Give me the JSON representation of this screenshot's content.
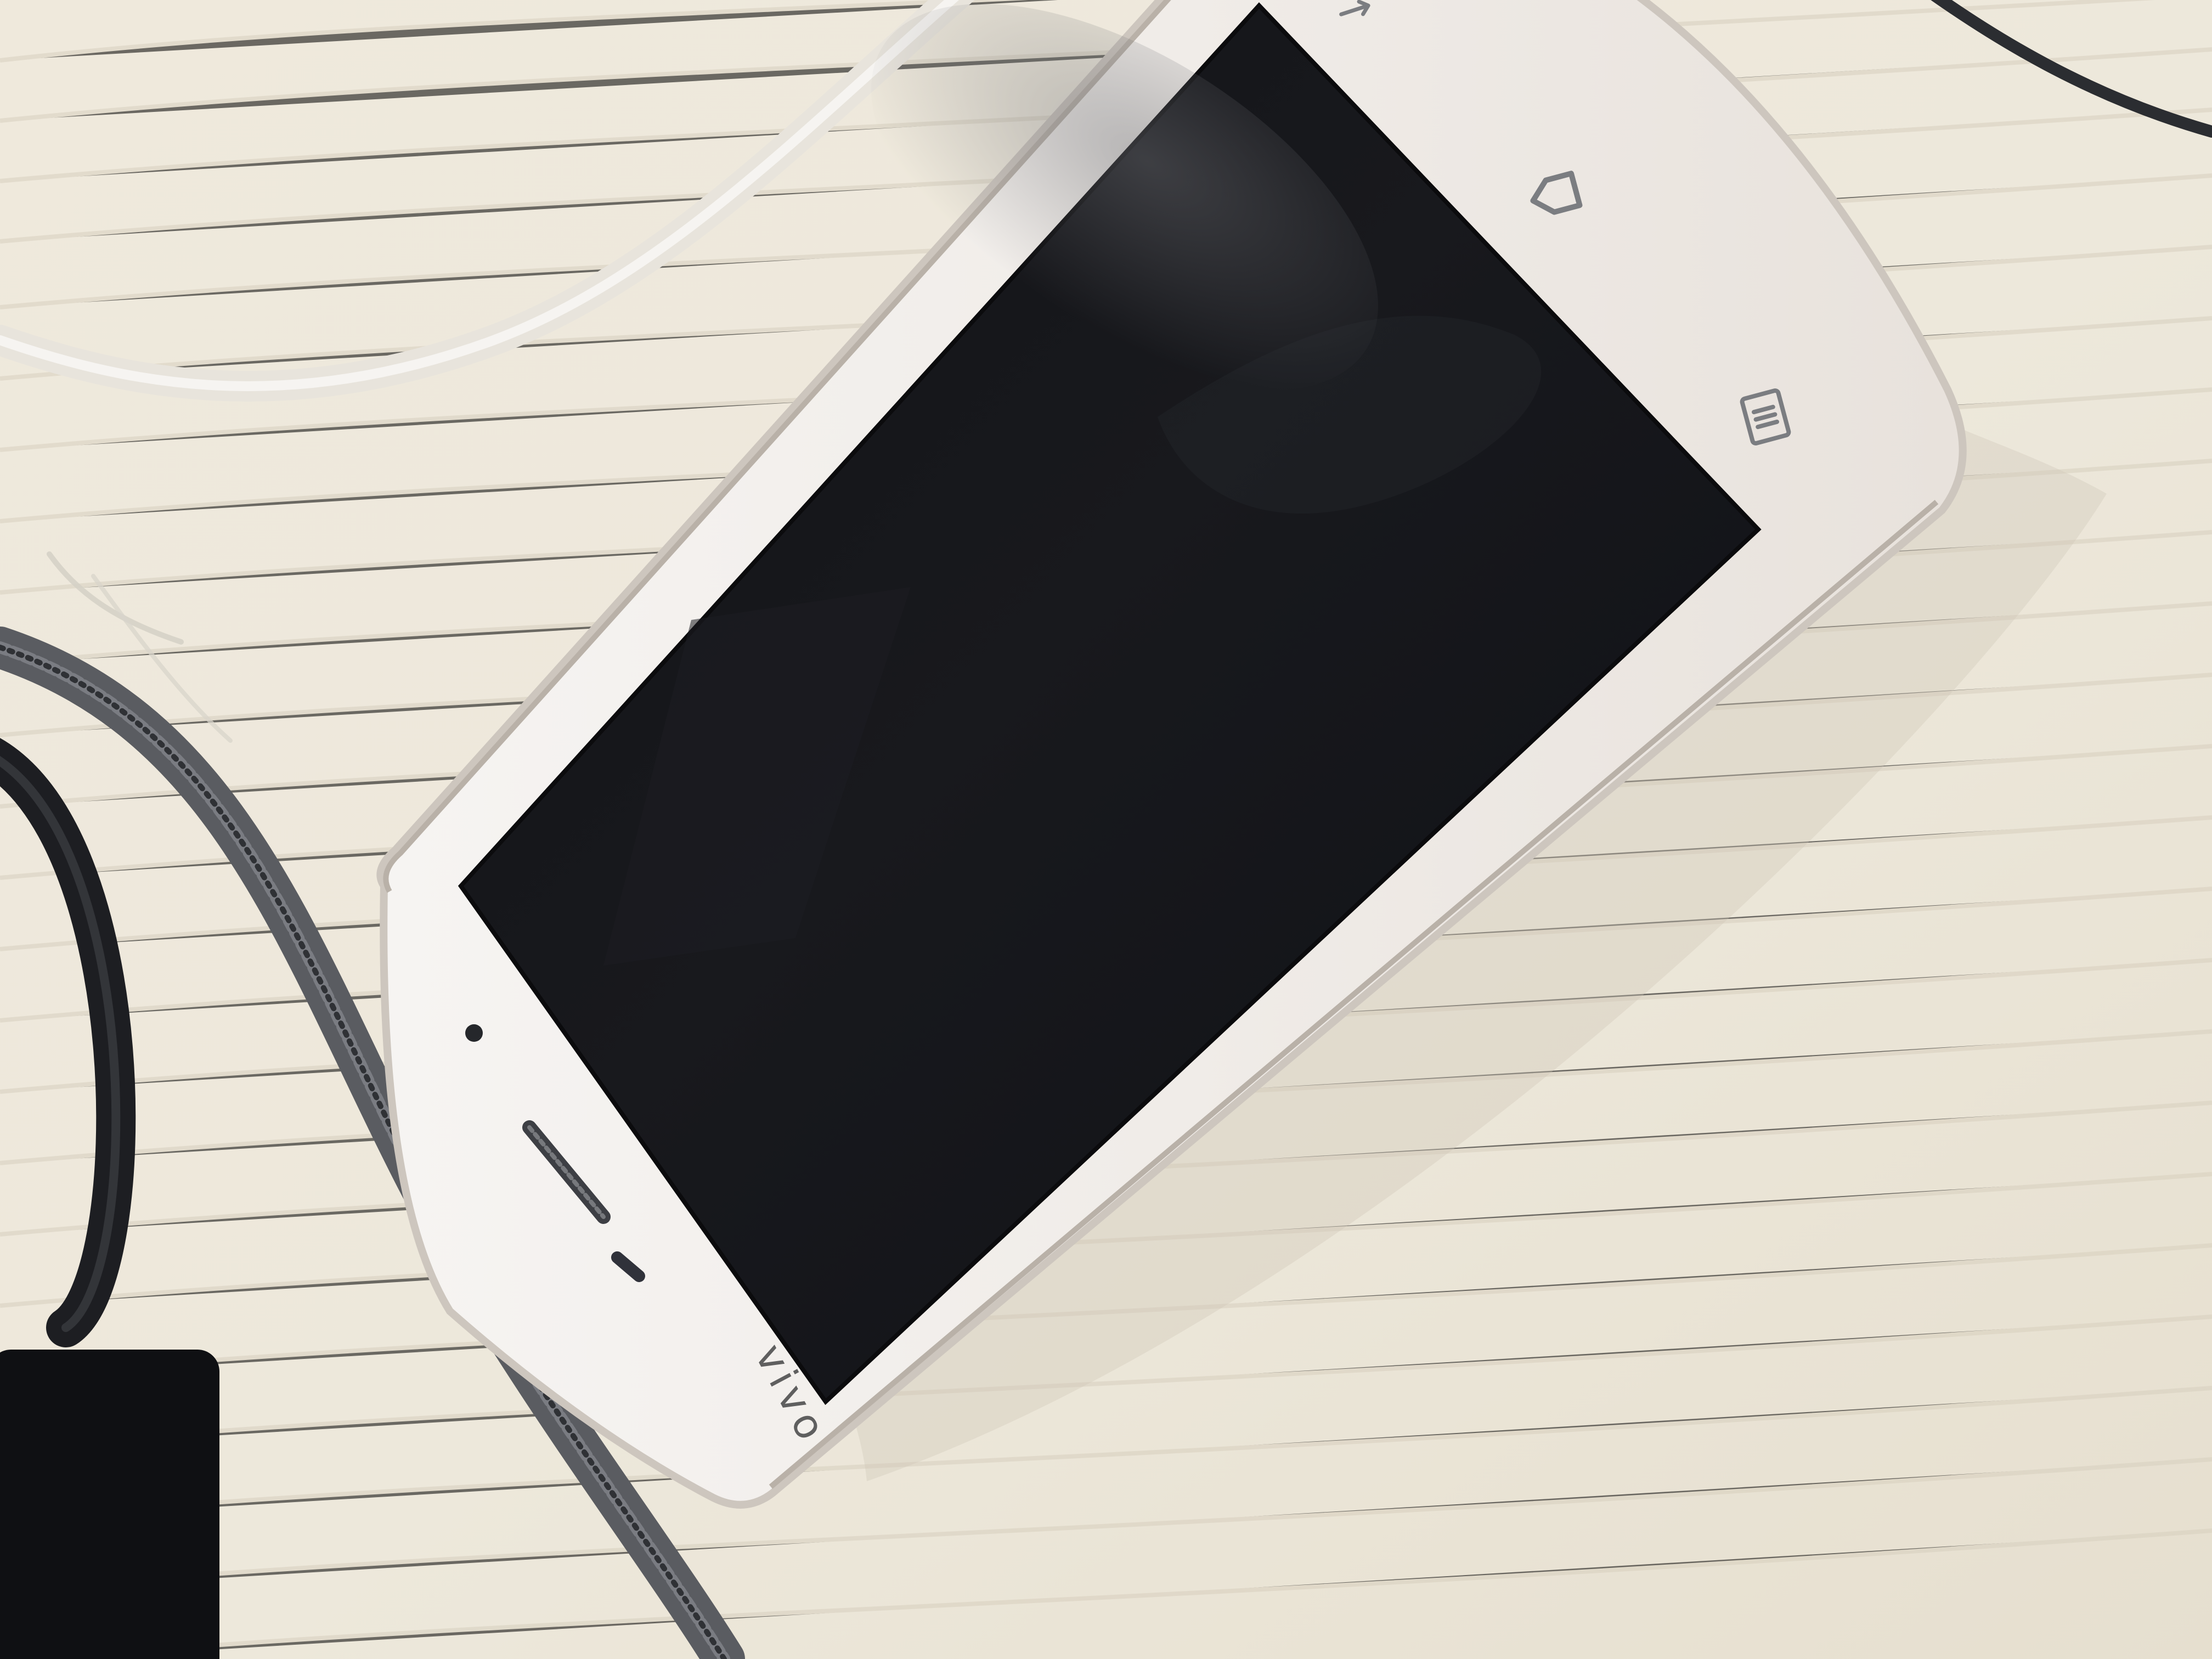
{
  "scene": {
    "brand_text": "vivo",
    "colors": {
      "table_base": "#ece6d7",
      "table_grain": "#d6cfbe",
      "phone_body": "#f4f1ef",
      "phone_edge": "#c8c1ba",
      "screen": "#17171c",
      "cable_white": "#e8e5dc",
      "cable_black": "#222327",
      "cable_braid": "#5d5f63"
    },
    "icons": [
      "back-button-icon",
      "menu-button-icon",
      "front-camera-icon",
      "earpiece-icon",
      "proximity-sensor-icon"
    ]
  }
}
